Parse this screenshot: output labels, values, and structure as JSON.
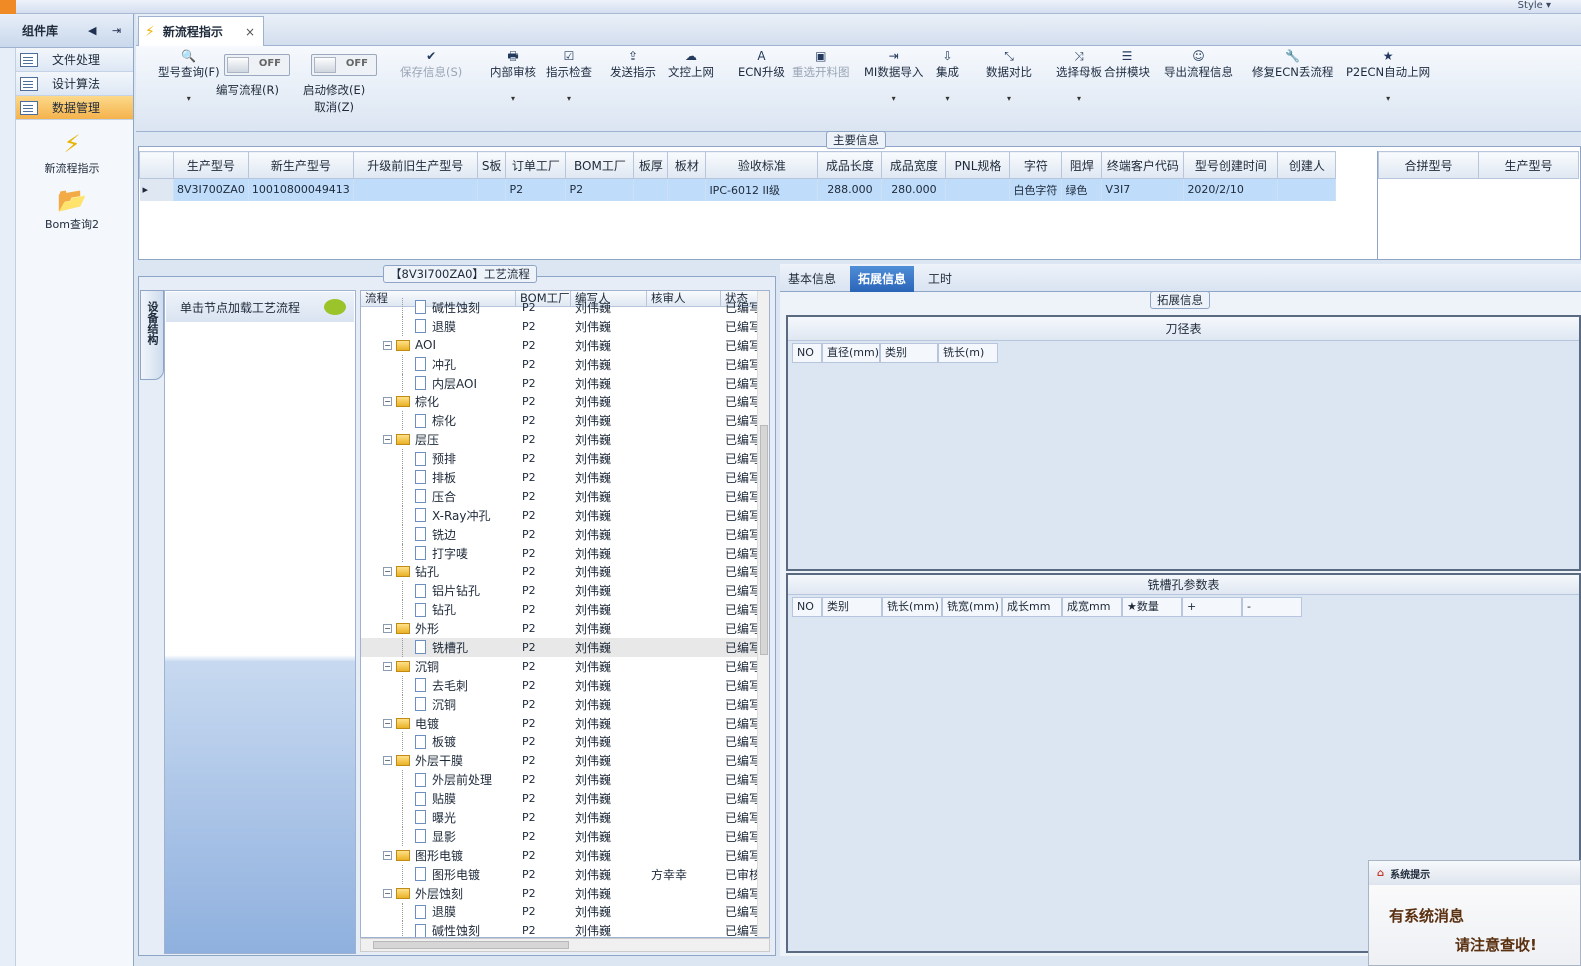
{
  "window": {
    "style_menu": "Style ▾"
  },
  "left_panel": {
    "title": "组件库",
    "items": [
      {
        "label": "文件处理",
        "active": false
      },
      {
        "label": "设计算法",
        "active": false
      },
      {
        "label": "数据管理",
        "active": true
      }
    ],
    "shortcuts": [
      {
        "label": "新流程指示",
        "icon": "lightning-icon"
      },
      {
        "label": "Bom查询2",
        "icon": "folder-icon"
      }
    ]
  },
  "doc_tab": {
    "title": "新流程指示",
    "close": "×"
  },
  "toolbar": {
    "buttons": [
      {
        "label": "型号查询(F)",
        "icon": "🔍",
        "dropdown": true,
        "disabled": false
      },
      {
        "label": "保存信息(S)",
        "icon": "✔",
        "dropdown": false,
        "disabled": true
      },
      {
        "label": "内部审核",
        "icon": "🖶",
        "dropdown": true,
        "disabled": false
      },
      {
        "label": "指示检查",
        "icon": "☑",
        "dropdown": true,
        "disabled": false
      },
      {
        "label": "发送指示",
        "icon": "⇪",
        "dropdown": false,
        "disabled": false
      },
      {
        "label": "文控上网",
        "icon": "☁",
        "dropdown": false,
        "disabled": false
      },
      {
        "label": "ECN升级",
        "icon": "A",
        "dropdown": false,
        "disabled": false
      },
      {
        "label": "重选开料图",
        "icon": "▣",
        "dropdown": false,
        "disabled": true
      },
      {
        "label": "MI数据导入",
        "icon": "⇥",
        "dropdown": true,
        "disabled": false
      },
      {
        "label": "集成",
        "icon": "⇩",
        "dropdown": true,
        "disabled": false
      },
      {
        "label": "数据对比",
        "icon": "⤡",
        "dropdown": true,
        "disabled": false
      },
      {
        "label": "选择母板",
        "icon": "⤨",
        "dropdown": true,
        "disabled": false
      },
      {
        "label": "合拼模块",
        "icon": "☰",
        "dropdown": false,
        "disabled": false
      },
      {
        "label": "导出流程信息",
        "icon": "☺",
        "dropdown": false,
        "disabled": false
      },
      {
        "label": "修复ECN丢流程",
        "icon": "🔧",
        "dropdown": false,
        "disabled": false
      },
      {
        "label": "P2ECN自动上网",
        "icon": "★",
        "dropdown": true,
        "disabled": false
      }
    ],
    "toggles": [
      {
        "label": "编写流程(R)",
        "state": "OFF"
      },
      {
        "label": "启动修改(E)\n取消(Z)",
        "state": "OFF"
      }
    ]
  },
  "main_info": {
    "title": "主要信息",
    "columns": [
      "生产型号",
      "新生产型号",
      "升级前旧生产型号",
      "S板",
      "订单工厂",
      "BOM工厂",
      "板厚",
      "板材",
      "验收标准",
      "成品长度",
      "成品宽度",
      "PNL规格",
      "字符",
      "阻焊",
      "终端客户代码",
      "型号创建时间",
      "创建人"
    ],
    "row": [
      "8V3I700ZA0",
      "10010800049413",
      "",
      "",
      "P2",
      "P2",
      "",
      "",
      "IPC-6012 II级",
      "288.000",
      "280.000",
      "",
      "白色字符",
      "绿色",
      "V3I7",
      "2020/2/10",
      ""
    ],
    "side_columns": [
      "合拼型号",
      "生产型号"
    ]
  },
  "process": {
    "title": "【8V3I700ZA0】工艺流程",
    "side_tab": "设备结构",
    "hint": "单击节点加载工艺流程",
    "columns": [
      "流程",
      "BOM工厂",
      "编写人",
      "核审人",
      "状态"
    ],
    "rows": [
      {
        "name": "碱性蚀刻",
        "level": 2,
        "type": "doc",
        "bom": "P2",
        "writer": "刘伟巍",
        "reviewer": "",
        "status": "已编写"
      },
      {
        "name": "退膜",
        "level": 2,
        "type": "doc",
        "bom": "P2",
        "writer": "刘伟巍",
        "reviewer": "",
        "status": "已编写"
      },
      {
        "name": "AOI",
        "level": 1,
        "type": "folder",
        "bom": "P2",
        "writer": "刘伟巍",
        "reviewer": "",
        "status": "已编写"
      },
      {
        "name": "冲孔",
        "level": 2,
        "type": "doc",
        "bom": "P2",
        "writer": "刘伟巍",
        "reviewer": "",
        "status": "已编写"
      },
      {
        "name": "内层AOI",
        "level": 2,
        "type": "doc",
        "bom": "P2",
        "writer": "刘伟巍",
        "reviewer": "",
        "status": "已编写"
      },
      {
        "name": "棕化",
        "level": 1,
        "type": "folder",
        "bom": "P2",
        "writer": "刘伟巍",
        "reviewer": "",
        "status": "已编写"
      },
      {
        "name": "棕化",
        "level": 2,
        "type": "doc",
        "bom": "P2",
        "writer": "刘伟巍",
        "reviewer": "",
        "status": "已编写"
      },
      {
        "name": "层压",
        "level": 1,
        "type": "folder",
        "bom": "P2",
        "writer": "刘伟巍",
        "reviewer": "",
        "status": "已编写"
      },
      {
        "name": "预排",
        "level": 2,
        "type": "doc",
        "bom": "P2",
        "writer": "刘伟巍",
        "reviewer": "",
        "status": "已编写"
      },
      {
        "name": "排板",
        "level": 2,
        "type": "doc",
        "bom": "P2",
        "writer": "刘伟巍",
        "reviewer": "",
        "status": "已编写"
      },
      {
        "name": "压合",
        "level": 2,
        "type": "doc",
        "bom": "P2",
        "writer": "刘伟巍",
        "reviewer": "",
        "status": "已编写"
      },
      {
        "name": "X-Ray冲孔",
        "level": 2,
        "type": "doc",
        "bom": "P2",
        "writer": "刘伟巍",
        "reviewer": "",
        "status": "已编写"
      },
      {
        "name": "铣边",
        "level": 2,
        "type": "doc",
        "bom": "P2",
        "writer": "刘伟巍",
        "reviewer": "",
        "status": "已编写"
      },
      {
        "name": "打字唛",
        "level": 2,
        "type": "doc",
        "bom": "P2",
        "writer": "刘伟巍",
        "reviewer": "",
        "status": "已编写"
      },
      {
        "name": "钻孔",
        "level": 1,
        "type": "folder",
        "bom": "P2",
        "writer": "刘伟巍",
        "reviewer": "",
        "status": "已编写"
      },
      {
        "name": "铝片钻孔",
        "level": 2,
        "type": "doc",
        "bom": "P2",
        "writer": "刘伟巍",
        "reviewer": "",
        "status": "已编写"
      },
      {
        "name": "钻孔",
        "level": 2,
        "type": "doc",
        "bom": "P2",
        "writer": "刘伟巍",
        "reviewer": "",
        "status": "已编写"
      },
      {
        "name": "外形",
        "level": 1,
        "type": "folder",
        "bom": "P2",
        "writer": "刘伟巍",
        "reviewer": "",
        "status": "已编写"
      },
      {
        "name": "铣槽孔",
        "level": 2,
        "type": "doc",
        "bom": "P2",
        "writer": "刘伟巍",
        "reviewer": "",
        "status": "已编写",
        "selected": true
      },
      {
        "name": "沉铜",
        "level": 1,
        "type": "folder",
        "bom": "P2",
        "writer": "刘伟巍",
        "reviewer": "",
        "status": "已编写"
      },
      {
        "name": "去毛刺",
        "level": 2,
        "type": "doc",
        "bom": "P2",
        "writer": "刘伟巍",
        "reviewer": "",
        "status": "已编写"
      },
      {
        "name": "沉铜",
        "level": 2,
        "type": "doc",
        "bom": "P2",
        "writer": "刘伟巍",
        "reviewer": "",
        "status": "已编写"
      },
      {
        "name": "电镀",
        "level": 1,
        "type": "folder",
        "bom": "P2",
        "writer": "刘伟巍",
        "reviewer": "",
        "status": "已编写"
      },
      {
        "name": "板镀",
        "level": 2,
        "type": "doc",
        "bom": "P2",
        "writer": "刘伟巍",
        "reviewer": "",
        "status": "已编写"
      },
      {
        "name": "外层干膜",
        "level": 1,
        "type": "folder",
        "bom": "P2",
        "writer": "刘伟巍",
        "reviewer": "",
        "status": "已编写"
      },
      {
        "name": "外层前处理",
        "level": 2,
        "type": "doc",
        "bom": "P2",
        "writer": "刘伟巍",
        "reviewer": "",
        "status": "已编写"
      },
      {
        "name": "贴膜",
        "level": 2,
        "type": "doc",
        "bom": "P2",
        "writer": "刘伟巍",
        "reviewer": "",
        "status": "已编写"
      },
      {
        "name": "曝光",
        "level": 2,
        "type": "doc",
        "bom": "P2",
        "writer": "刘伟巍",
        "reviewer": "",
        "status": "已编写"
      },
      {
        "name": "显影",
        "level": 2,
        "type": "doc",
        "bom": "P2",
        "writer": "刘伟巍",
        "reviewer": "",
        "status": "已编写"
      },
      {
        "name": "图形电镀",
        "level": 1,
        "type": "folder",
        "bom": "P2",
        "writer": "刘伟巍",
        "reviewer": "",
        "status": "已编写"
      },
      {
        "name": "图形电镀",
        "level": 2,
        "type": "doc",
        "bom": "P2",
        "writer": "刘伟巍",
        "reviewer": "方幸幸",
        "status": "已审核"
      },
      {
        "name": "外层蚀刻",
        "level": 1,
        "type": "folder",
        "bom": "P2",
        "writer": "刘伟巍",
        "reviewer": "",
        "status": "已编写"
      },
      {
        "name": "退膜",
        "level": 2,
        "type": "doc",
        "bom": "P2",
        "writer": "刘伟巍",
        "reviewer": "",
        "status": "已编写"
      },
      {
        "name": "碱性蚀刻",
        "level": 2,
        "type": "doc",
        "bom": "P2",
        "writer": "刘伟巍",
        "reviewer": "",
        "status": "已编写"
      }
    ]
  },
  "right_tabs": [
    {
      "label": "基本信息",
      "active": false
    },
    {
      "label": "拓展信息",
      "active": true
    },
    {
      "label": "工时",
      "active": false
    }
  ],
  "ext_info": {
    "title": "拓展信息",
    "knife_table": {
      "title": "刀径表",
      "columns": [
        "NO",
        "直径(mm)",
        "类别",
        "铣长(m)"
      ]
    },
    "slot_table": {
      "title": "铣槽孔参数表",
      "columns": [
        "NO",
        "类别",
        "铣长(mm)",
        "铣宽(mm)",
        "成长mm",
        "成宽mm",
        "★数量",
        "+",
        "-"
      ]
    }
  },
  "notification": {
    "title": "系统提示",
    "line1": "有系统消息",
    "line2": "请注意查收!"
  }
}
